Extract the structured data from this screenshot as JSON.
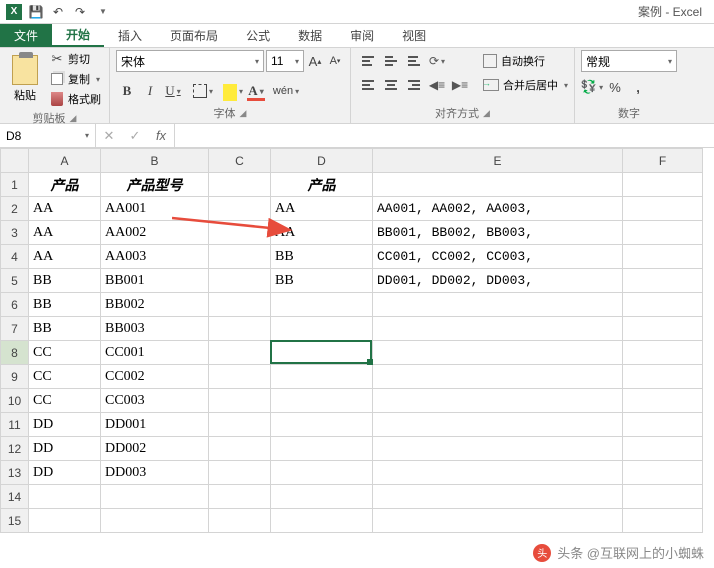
{
  "app": {
    "title": "案例 - Excel"
  },
  "tabs": {
    "file": "文件",
    "home": "开始",
    "insert": "插入",
    "layout": "页面布局",
    "formulas": "公式",
    "data": "数据",
    "review": "审阅",
    "view": "视图"
  },
  "ribbon": {
    "clipboard": {
      "paste": "粘贴",
      "cut": "剪切",
      "copy": "复制",
      "format_painter": "格式刷",
      "label": "剪贴板"
    },
    "font": {
      "name": "宋体",
      "size": "11",
      "bold": "B",
      "italic": "I",
      "underline": "U",
      "phonetic": "wén",
      "label": "字体"
    },
    "alignment": {
      "wrap": "自动换行",
      "merge": "合并后居中",
      "label": "对齐方式"
    },
    "number": {
      "format": "常规",
      "label": "数字"
    }
  },
  "formula_bar": {
    "name_box": "D8",
    "fx": "fx"
  },
  "columns": [
    "A",
    "B",
    "C",
    "D",
    "E",
    "F"
  ],
  "sheet": {
    "headers": {
      "A1": "产品",
      "B1": "产品型号",
      "D1": "产品"
    },
    "rows": [
      {
        "a": "AA",
        "b": "AA001",
        "d": "AA",
        "e": "AA001, AA002, AA003,"
      },
      {
        "a": "AA",
        "b": "AA002",
        "d": "AA",
        "e": "BB001, BB002, BB003,"
      },
      {
        "a": "AA",
        "b": "AA003",
        "d": "BB",
        "e": "CC001, CC002, CC003,"
      },
      {
        "a": "BB",
        "b": "BB001",
        "d": "BB",
        "e": "DD001, DD002, DD003,"
      },
      {
        "a": "BB",
        "b": "BB002",
        "d": "",
        "e": ""
      },
      {
        "a": "BB",
        "b": "BB003",
        "d": "",
        "e": ""
      },
      {
        "a": "CC",
        "b": "CC001",
        "d": "",
        "e": ""
      },
      {
        "a": "CC",
        "b": "CC002",
        "d": "",
        "e": ""
      },
      {
        "a": "CC",
        "b": "CC003",
        "d": "",
        "e": ""
      },
      {
        "a": "DD",
        "b": "DD001",
        "d": "",
        "e": ""
      },
      {
        "a": "DD",
        "b": "DD002",
        "d": "",
        "e": ""
      },
      {
        "a": "DD",
        "b": "DD003",
        "d": "",
        "e": ""
      },
      {
        "a": "",
        "b": "",
        "d": "",
        "e": ""
      },
      {
        "a": "",
        "b": "",
        "d": "",
        "e": ""
      }
    ]
  },
  "watermark": "头条 @互联网上的小蜘蛛"
}
